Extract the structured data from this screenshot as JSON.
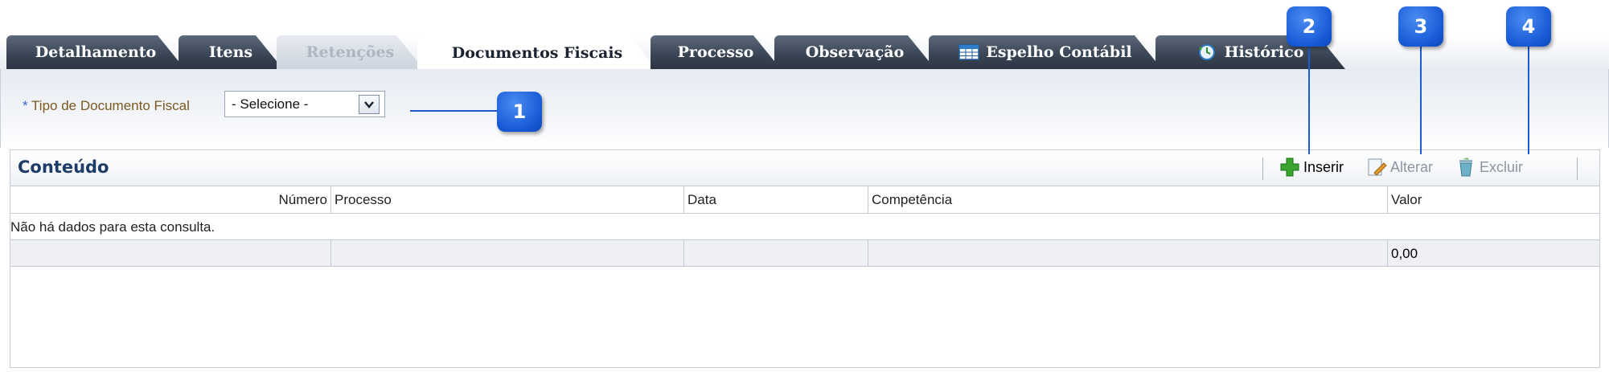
{
  "tabs": [
    {
      "label": "Detalhamento",
      "state": "normal"
    },
    {
      "label": "Itens",
      "state": "normal"
    },
    {
      "label": "Retenções",
      "state": "disabled"
    },
    {
      "label": "Documentos Fiscais",
      "state": "active"
    },
    {
      "label": "Processo",
      "state": "normal"
    },
    {
      "label": "Observação",
      "state": "normal"
    },
    {
      "label": "Espelho Contábil",
      "state": "normal",
      "icon": "spreadsheet-icon"
    },
    {
      "label": "Histórico",
      "state": "normal",
      "icon": "clock-icon"
    }
  ],
  "filter": {
    "required_mark": "*",
    "label": "Tipo de Documento Fiscal",
    "select_value": "- Selecione -"
  },
  "panel": {
    "title": "Conteúdo",
    "toolbar": {
      "insert": "Inserir",
      "edit": "Alterar",
      "delete": "Excluir"
    }
  },
  "table": {
    "columns": [
      "Número",
      "Processo",
      "Data",
      "Competência",
      "Valor"
    ],
    "empty_message": "Não há dados para esta consulta.",
    "total_value": "0,00"
  },
  "callouts": [
    "1",
    "2",
    "3",
    "4"
  ],
  "colors": {
    "tab_dark": "#3b4656",
    "callout_blue": "#1659d6",
    "panel_title": "#1d3b67",
    "insert_icon": "#3aa52e"
  }
}
